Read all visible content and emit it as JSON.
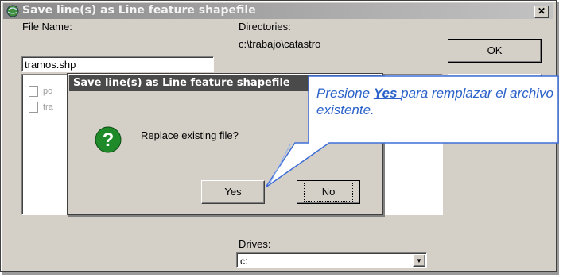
{
  "window": {
    "title": "Save line(s) as Line feature shapefile",
    "close_label": "✕",
    "file_name_label": "File Name:",
    "file_name_value": "tramos.shp",
    "file_list": [
      "po",
      "tra"
    ],
    "directories_label": "Directories:",
    "directories_value": "c:\\trabajo\\catastro",
    "ok_label": "OK",
    "drives_label": "Drives:",
    "drive_value": "c:"
  },
  "dialog": {
    "title": "Save line(s) as Line feature shapefile",
    "message": "Replace existing file?",
    "yes_label": "Yes",
    "no_label": "No",
    "icon": "question-icon"
  },
  "callout": {
    "prefix": "Presione ",
    "keyword": "Yes ",
    "suffix": "para remplazar el archivo existente."
  },
  "colors": {
    "callout_text": "#2a62c9",
    "callout_border": "#3f6ed8",
    "icon_green": "#1f8a2a"
  }
}
